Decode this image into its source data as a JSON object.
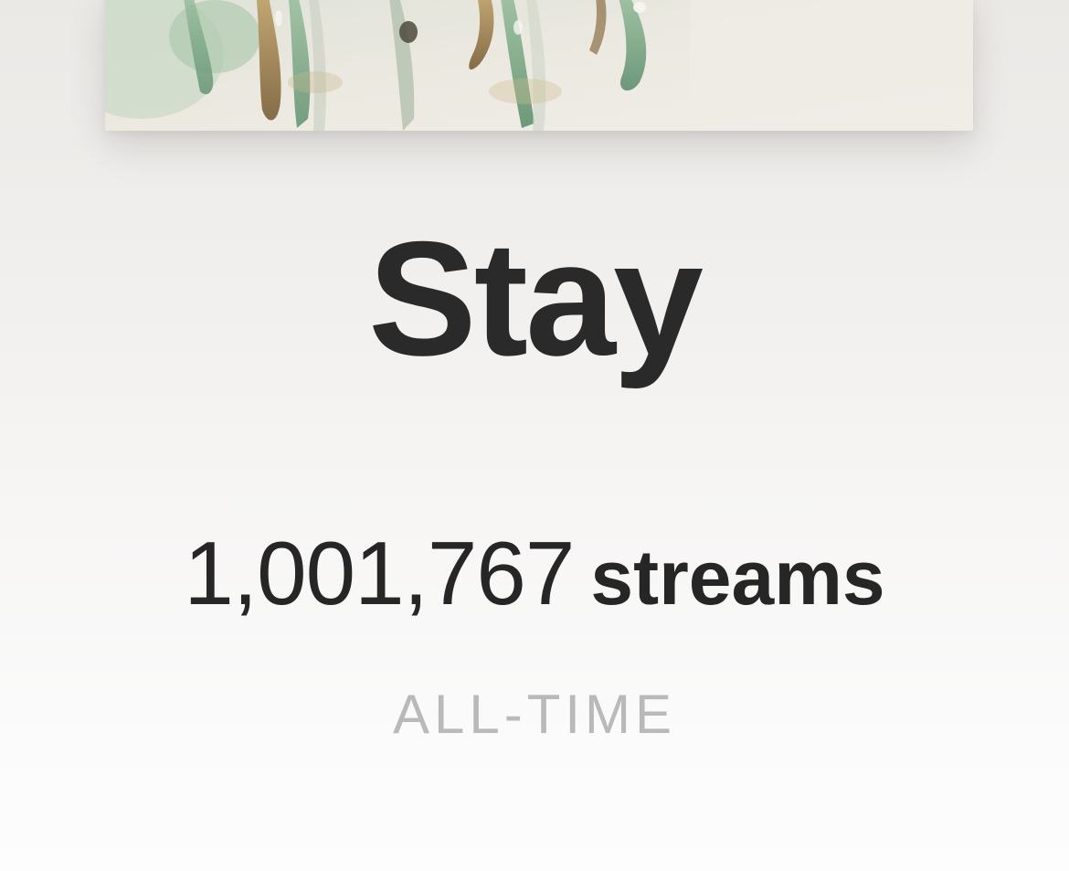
{
  "track": {
    "title": "Stay",
    "stream_count": "1,001,767",
    "stream_unit": "streams",
    "period": "ALL-TIME"
  },
  "artwork": {
    "icon": "album-art-image",
    "colors": {
      "background": "#e9e6de",
      "green": "#7fae8f",
      "amber": "#a8894e",
      "brown": "#5b4631"
    }
  }
}
